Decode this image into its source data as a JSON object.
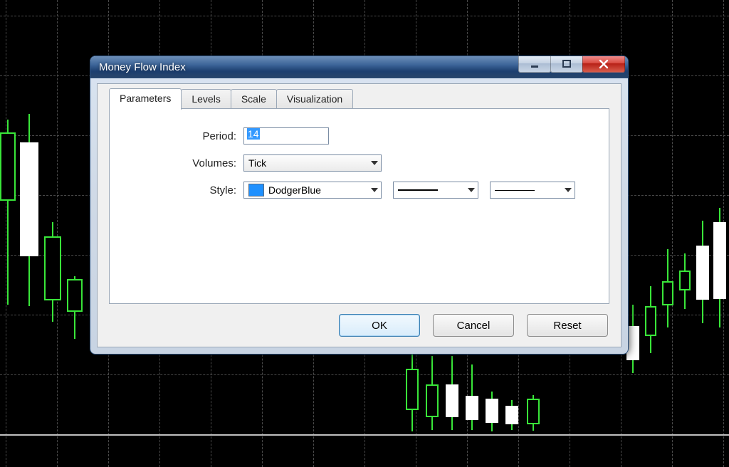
{
  "dialog": {
    "title": "Money Flow Index",
    "tabs": [
      "Parameters",
      "Levels",
      "Scale",
      "Visualization"
    ],
    "active_tab": "Parameters",
    "labels": {
      "period": "Period:",
      "volumes": "Volumes:",
      "style": "Style:"
    },
    "fields": {
      "period_value": "14",
      "volumes_value": "Tick",
      "style_color_name": "DodgerBlue",
      "style_color_hex": "#1e90ff"
    },
    "buttons": {
      "ok": "OK",
      "cancel": "Cancel",
      "reset": "Reset"
    }
  }
}
